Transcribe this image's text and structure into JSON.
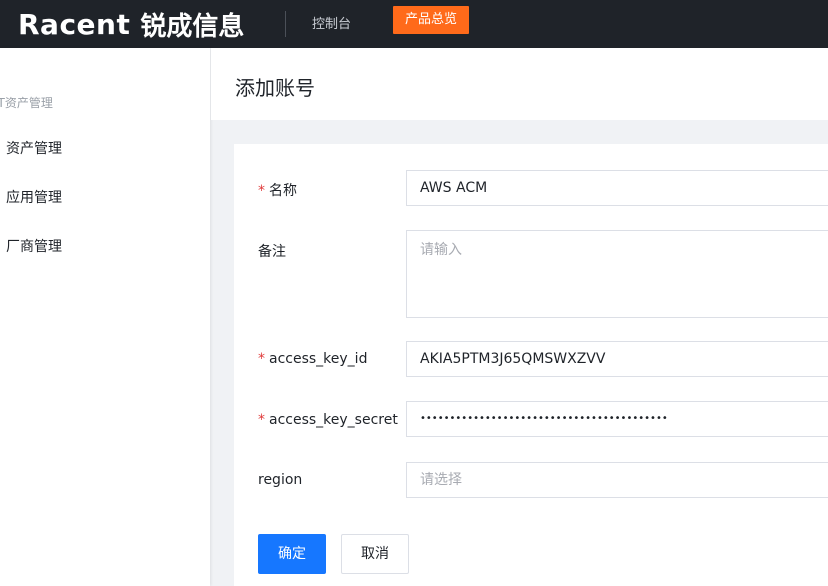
{
  "topbar": {
    "logo_latin": "Racent",
    "logo_cn": "锐成信息",
    "nav_console": "控制台",
    "nav_product": "产品总览"
  },
  "sidebar": {
    "group_title": "IT资产管理",
    "items": [
      {
        "label": "资产管理"
      },
      {
        "label": "应用管理"
      },
      {
        "label": "厂商管理"
      }
    ]
  },
  "page": {
    "title": "添加账号"
  },
  "form": {
    "name": {
      "label": "名称",
      "required": true,
      "value": "AWS ACM"
    },
    "remark": {
      "label": "备注",
      "required": false,
      "placeholder": "请输入"
    },
    "access_key_id": {
      "label": "access_key_id",
      "required": true,
      "value": "AKIA5PTM3J65QMSWXZVV"
    },
    "access_key_secret": {
      "label": "access_key_secret",
      "required": true,
      "value": "••••••••••••••••••••••••••••••••••••••••••"
    },
    "region": {
      "label": "region",
      "required": false,
      "placeholder": "请选择"
    },
    "confirm_label": "确定",
    "cancel_label": "取消"
  },
  "colors": {
    "topbar_bg": "#1f2329",
    "accent_orange": "#ff6a1a",
    "primary_blue": "#1677ff",
    "required_red": "#e03a3a"
  }
}
